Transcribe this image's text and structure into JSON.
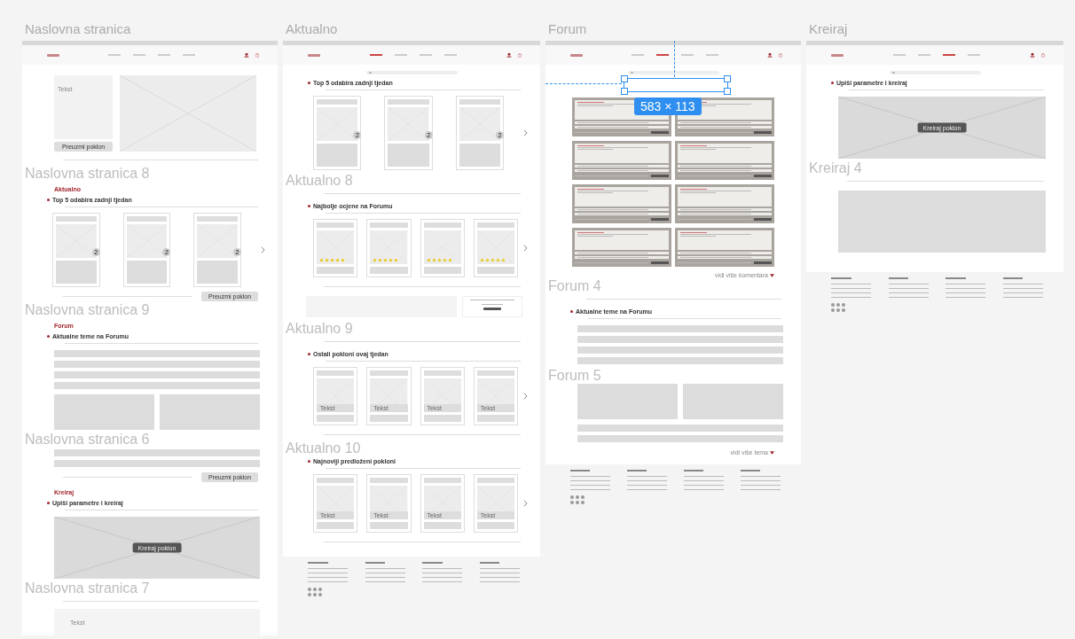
{
  "canvas": {
    "columns": [
      {
        "title": "Naslovna stranica",
        "sections": [
          {
            "kind": "nav",
            "links": [
              {
                "selected": false
              },
              {
                "selected": false
              },
              {
                "selected": false
              },
              {
                "selected": false
              }
            ]
          },
          {
            "kind": "hero",
            "text": "Tekst",
            "button": "Preuzmi poklon"
          },
          {
            "kind": "divider"
          },
          {
            "kind": "frame_label",
            "text": "Naslovna stranica 8"
          },
          {
            "kind": "heading",
            "text": "Aktualno"
          },
          {
            "kind": "section_title",
            "text": "Top 5 odabira zadnji tjedan"
          },
          {
            "kind": "cards",
            "items": [
              {
                "kind": "top",
                "badge": "2"
              },
              {
                "kind": "top",
                "badge": "2"
              },
              {
                "kind": "top",
                "badge": "2"
              }
            ]
          },
          {
            "kind": "divider_button",
            "button": "Preuzmi poklon"
          },
          {
            "kind": "frame_label",
            "text": "Naslovna stranica 9"
          },
          {
            "kind": "heading",
            "text": "Forum"
          },
          {
            "kind": "section_title",
            "text": "Aktualne teme na Forumu"
          },
          {
            "kind": "rows",
            "rows": [
              {
                "kind": "bar"
              },
              {
                "kind": "bar"
              },
              {
                "kind": "bar"
              },
              {
                "kind": "bar"
              }
            ]
          },
          {
            "kind": "blocks"
          },
          {
            "kind": "frame_label",
            "text": "Naslovna stranica 6"
          },
          {
            "kind": "rows",
            "rows": [
              {
                "kind": "bar"
              },
              {
                "kind": "bar"
              }
            ]
          },
          {
            "kind": "divider_button",
            "button": "Preuzmi poklon"
          },
          {
            "kind": "heading",
            "text": "Kreiraj"
          },
          {
            "kind": "section_title",
            "text": "Upiši parametre i kreiraj"
          },
          {
            "kind": "image_button",
            "button": "Kreiraj poklon"
          },
          {
            "kind": "frame_label",
            "text": "Naslovna stranica 7"
          },
          {
            "kind": "divider"
          },
          {
            "kind": "text_panel",
            "text": "Tekst"
          }
        ]
      },
      {
        "title": "Aktualno",
        "sections": [
          {
            "kind": "nav",
            "links": [
              {
                "selected": true
              },
              {
                "selected": false
              },
              {
                "selected": false
              },
              {
                "selected": false
              }
            ]
          },
          {
            "kind": "search"
          },
          {
            "kind": "section_title",
            "text": "Top 5 odabira zadnji tjedan"
          },
          {
            "kind": "cards",
            "items": [
              {
                "kind": "top",
                "badge": "2"
              },
              {
                "kind": "top",
                "badge": "2"
              },
              {
                "kind": "top",
                "badge": "2"
              }
            ]
          },
          {
            "kind": "frame_label",
            "text": "Aktualno 8"
          },
          {
            "kind": "divider"
          },
          {
            "kind": "section_title",
            "text": "Najbolje ocjene na Forumu"
          },
          {
            "kind": "cards",
            "items": [
              {
                "kind": "rated",
                "stars": 5
              },
              {
                "kind": "rated",
                "stars": 5
              },
              {
                "kind": "rated",
                "stars": 5
              },
              {
                "kind": "rated",
                "stars": 5
              }
            ]
          },
          {
            "kind": "divider"
          },
          {
            "kind": "promo"
          },
          {
            "kind": "frame_label",
            "text": "Aktualno 9"
          },
          {
            "kind": "divider"
          },
          {
            "kind": "section_title",
            "text": "Ostali pokloni ovaj tjedan"
          },
          {
            "kind": "cards",
            "items": [
              {
                "kind": "text",
                "caption": "Tekst"
              },
              {
                "kind": "text",
                "caption": "Tekst"
              },
              {
                "kind": "text",
                "caption": "Tekst"
              },
              {
                "kind": "text",
                "caption": "Tekst"
              }
            ]
          },
          {
            "kind": "divider"
          },
          {
            "kind": "frame_label",
            "text": "Aktualno 10"
          },
          {
            "kind": "section_title",
            "text": "Najnoviji predloženi pokloni"
          },
          {
            "kind": "cards",
            "items": [
              {
                "kind": "text",
                "caption": "Tekst"
              },
              {
                "kind": "text",
                "caption": "Tekst"
              },
              {
                "kind": "text",
                "caption": "Tekst"
              },
              {
                "kind": "text",
                "caption": "Tekst"
              }
            ]
          },
          {
            "kind": "divider"
          },
          {
            "kind": "footer"
          }
        ]
      },
      {
        "title": "Forum",
        "sections": [
          {
            "kind": "nav",
            "links": [
              {
                "selected": false
              },
              {
                "selected": true
              },
              {
                "selected": false
              },
              {
                "selected": false
              }
            ]
          },
          {
            "kind": "search"
          },
          {
            "kind": "selection",
            "label": "583 × 113"
          },
          {
            "kind": "forum_grid",
            "cards": [
              {
                "kind": "topic"
              },
              {
                "kind": "topic"
              },
              {
                "kind": "topic"
              },
              {
                "kind": "topic"
              },
              {
                "kind": "topic"
              },
              {
                "kind": "topic"
              },
              {
                "kind": "topic"
              },
              {
                "kind": "topic"
              }
            ]
          },
          {
            "kind": "more_link",
            "text": "vidi više komentara"
          },
          {
            "kind": "frame_label",
            "text": "Forum 4"
          },
          {
            "kind": "divider"
          },
          {
            "kind": "section_title",
            "text": "Aktualne teme na Forumu"
          },
          {
            "kind": "rows",
            "rows": [
              {
                "kind": "bar"
              },
              {
                "kind": "bar"
              },
              {
                "kind": "bar"
              },
              {
                "kind": "bar"
              }
            ]
          },
          {
            "kind": "frame_label",
            "text": "Forum 5"
          },
          {
            "kind": "blocks"
          },
          {
            "kind": "rows",
            "rows": [
              {
                "kind": "bar"
              },
              {
                "kind": "bar"
              }
            ]
          },
          {
            "kind": "more_link",
            "text": "vidi više tema"
          },
          {
            "kind": "footer"
          }
        ]
      },
      {
        "title": "Kreiraj",
        "sections": [
          {
            "kind": "nav",
            "links": [
              {
                "selected": false
              },
              {
                "selected": false
              },
              {
                "selected": true
              },
              {
                "selected": false
              }
            ]
          },
          {
            "kind": "search"
          },
          {
            "kind": "section_title",
            "text": "Upiši parametre i kreiraj"
          },
          {
            "kind": "image_button",
            "button": "Kreiraj poklon"
          },
          {
            "kind": "frame_label",
            "text": "Kreiraj 4"
          },
          {
            "kind": "divider"
          },
          {
            "kind": "gray_block"
          },
          {
            "kind": "footer"
          }
        ]
      }
    ]
  }
}
